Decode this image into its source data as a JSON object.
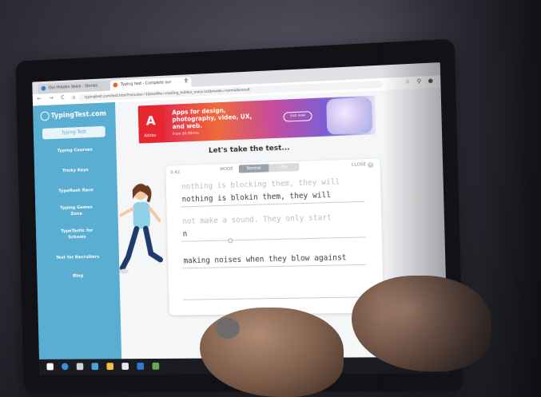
{
  "browser": {
    "tabs": [
      {
        "label": "Our Hidden Voice - Stories"
      },
      {
        "label": "Typing test - Complete our"
      }
    ],
    "new_tab": "+",
    "nav_buttons": "← → C ⌂",
    "url": "typingtest.com/test.html?minutes=1&textfile=reading_hidden_voice.txt&mode=normal&result",
    "account_icons": "☆ ⚲ ●"
  },
  "sidebar": {
    "logo": "TypingTest.com",
    "active_item": "Typing Test",
    "items": [
      "Typing Courses",
      "Tricky Keys",
      "TypeRush Race",
      "Typing Games Zone",
      "TypeTastic for Schools",
      "Test for Recruiters",
      "Blog"
    ]
  },
  "ad": {
    "brand": "Adobe",
    "logo_glyph": "A",
    "headline": "Apps for design, photography, video, UX, and web.",
    "subline": "From $9.99/mo",
    "button": "Get now"
  },
  "test": {
    "headline": "Let's take the test...",
    "timer": "0:42",
    "mode_label": "MODE",
    "mode_normal": "Normal",
    "mode_pro": "Pro",
    "close": "CLOSE",
    "lines": [
      {
        "ghost": "nothing is blocking them, they will",
        "typed": "nothing is blokin  them, they will"
      },
      {
        "ghost": "not make a sound. They only start",
        "typed": "n"
      },
      {
        "ghost": "",
        "typed": "making noises when they blow against"
      }
    ]
  },
  "colors": {
    "sidebar": "#5aaed2",
    "ad_red": "#e8262e",
    "background": "#f5f6f8"
  }
}
